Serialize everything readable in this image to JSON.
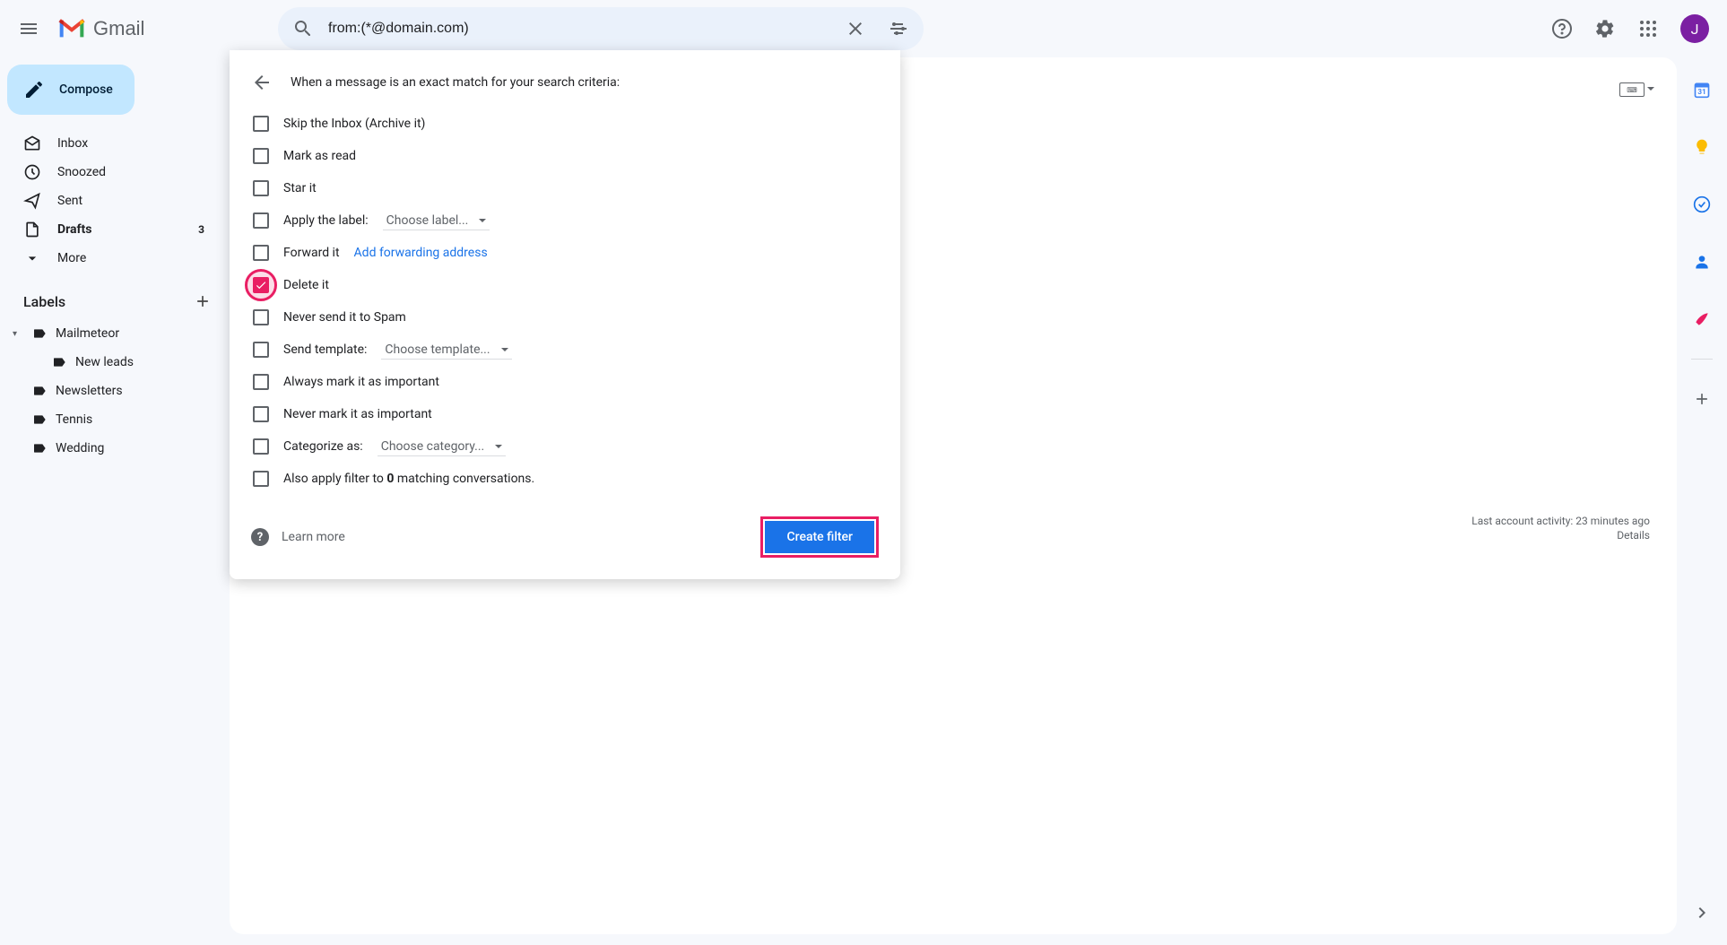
{
  "header": {
    "product_name": "Gmail",
    "search_value": "from:(*@domain.com)",
    "avatar_initial": "J"
  },
  "sidebar": {
    "compose_label": "Compose",
    "nav": [
      {
        "label": "Inbox",
        "icon": "inbox",
        "count": "",
        "bold": false
      },
      {
        "label": "Snoozed",
        "icon": "clock",
        "count": "",
        "bold": false
      },
      {
        "label": "Sent",
        "icon": "send",
        "count": "",
        "bold": false
      },
      {
        "label": "Drafts",
        "icon": "file",
        "count": "3",
        "bold": true
      },
      {
        "label": "More",
        "icon": "chevron-down",
        "count": "",
        "bold": false
      }
    ],
    "labels_header": "Labels",
    "labels": [
      {
        "name": "Mailmeteor",
        "expandable": true,
        "nested": false
      },
      {
        "name": "New leads",
        "expandable": false,
        "nested": true
      },
      {
        "name": "Newsletters",
        "expandable": false,
        "nested": false
      },
      {
        "name": "Tennis",
        "expandable": false,
        "nested": false
      },
      {
        "name": "Wedding",
        "expandable": false,
        "nested": false
      }
    ]
  },
  "filter_panel": {
    "title": "When a message is an exact match for your search criteria:",
    "options": {
      "skip_inbox": "Skip the Inbox (Archive it)",
      "mark_read": "Mark as read",
      "star": "Star it",
      "apply_label": "Apply the label:",
      "choose_label": "Choose label...",
      "forward": "Forward it",
      "add_forwarding": "Add forwarding address",
      "delete": "Delete it",
      "never_spam": "Never send it to Spam",
      "send_template": "Send template:",
      "choose_template": "Choose template...",
      "always_important": "Always mark it as important",
      "never_important": "Never mark it as important",
      "categorize": "Categorize as:",
      "choose_category": "Choose category...",
      "also_apply_prefix": "Also apply filter to ",
      "also_apply_count": "0",
      "also_apply_suffix": " matching conversations."
    },
    "learn_more": "Learn more",
    "create_filter": "Create filter"
  },
  "content": {
    "activity_line": "Last account activity: 23 minutes ago",
    "details_link": "Details"
  },
  "side_rail": {
    "items": [
      "calendar",
      "keep",
      "tasks",
      "contacts",
      "mailmeteor",
      "add"
    ]
  }
}
